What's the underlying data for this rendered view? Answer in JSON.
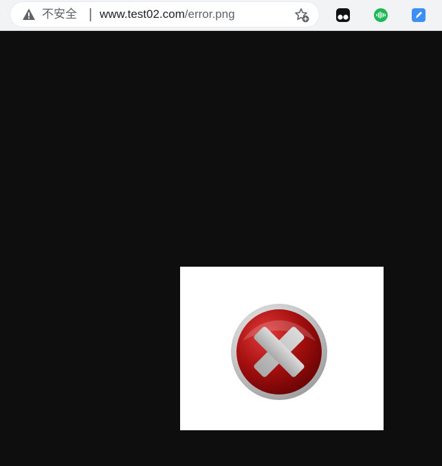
{
  "browser": {
    "security_label": "不安全",
    "divider": "|",
    "url_host": "www.test02.com",
    "url_path": "/error.png",
    "icons": {
      "security": "warning-triangle-icon",
      "bookmark": "star-add-icon",
      "extension_1": "tampermonkey-icon",
      "extension_2": "audio-wave-icon",
      "extension_3": "pencil-edit-icon"
    },
    "colors": {
      "toolbar_bg": "#f1f3f4",
      "ext_wave_green": "#1db954",
      "ext_edit_blue": "#3d8ef7"
    }
  },
  "content": {
    "background": "#0e0e0e",
    "image": {
      "icon": "error-x-icon",
      "colors": {
        "circle": "#a50f0f",
        "cross": "#bdbdbd"
      }
    }
  }
}
